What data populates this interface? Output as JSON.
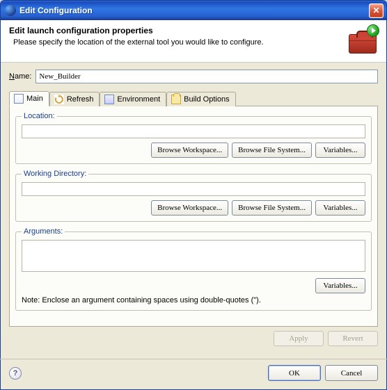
{
  "window": {
    "title": "Edit Configuration",
    "close_label": "✕"
  },
  "header": {
    "heading": "Edit launch configuration properties",
    "description": "Please specify the location of the external tool you would like to configure."
  },
  "name": {
    "label": "Name:",
    "mnemonic": "N",
    "rest": "ame:",
    "value": "New_Builder"
  },
  "tabs": [
    {
      "id": "main",
      "label": "Main",
      "active": true
    },
    {
      "id": "refresh",
      "label": "Refresh",
      "active": false
    },
    {
      "id": "environment",
      "label": "Environment",
      "active": false
    },
    {
      "id": "build",
      "label": "Build Options",
      "active": false
    }
  ],
  "groups": {
    "location": {
      "legend": "Location:",
      "value": "",
      "buttons": {
        "workspace": "Browse Workspace...",
        "filesystem": "Browse File System...",
        "variables": "Variables..."
      }
    },
    "workdir": {
      "legend": "Working Directory:",
      "value": "",
      "buttons": {
        "workspace": "Browse Workspace...",
        "filesystem": "Browse File System...",
        "variables": "Variables..."
      }
    },
    "arguments": {
      "legend": "Arguments:",
      "value": "",
      "buttons": {
        "variables": "Variables..."
      },
      "note": "Note: Enclose an argument containing spaces using double-quotes (\")."
    }
  },
  "actions": {
    "apply": "Apply",
    "revert": "Revert"
  },
  "footer": {
    "ok": "OK",
    "cancel": "Cancel",
    "help": "?"
  }
}
